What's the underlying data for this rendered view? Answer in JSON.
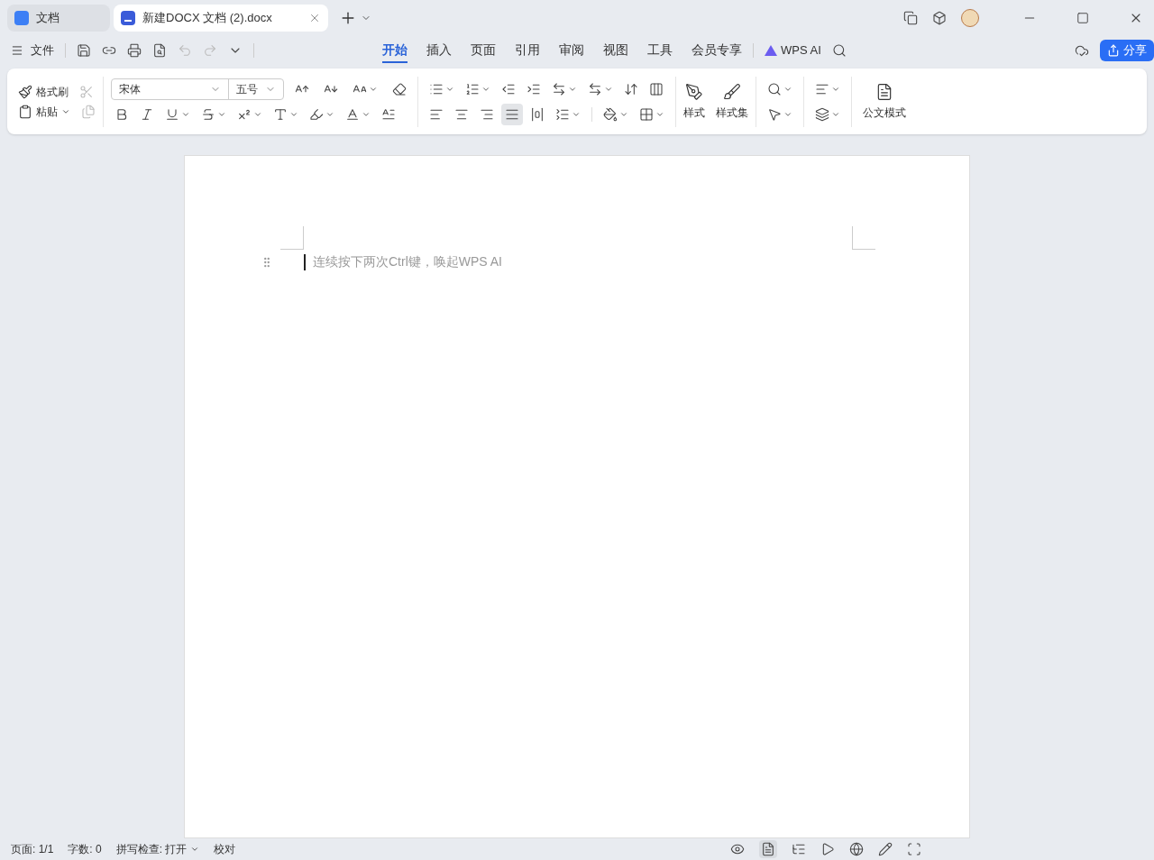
{
  "doc_tabs": [
    {
      "label": "文档",
      "kind": "home",
      "selected": false
    },
    {
      "label": "新建DOCX 文档 (2).docx",
      "kind": "word",
      "selected": true
    }
  ],
  "menu": {
    "file": "文件"
  },
  "ribbon_tabs": [
    {
      "label": "开始",
      "selected": true
    },
    {
      "label": "插入",
      "selected": false
    },
    {
      "label": "页面",
      "selected": false
    },
    {
      "label": "引用",
      "selected": false
    },
    {
      "label": "审阅",
      "selected": false
    },
    {
      "label": "视图",
      "selected": false
    },
    {
      "label": "工具",
      "selected": false
    },
    {
      "label": "会员专享",
      "selected": false
    }
  ],
  "ai_label": "WPS AI",
  "share": "分享",
  "clipboard": {
    "format_painter": "格式刷",
    "paste": "粘贴"
  },
  "font": {
    "name": "宋体",
    "size": "五号"
  },
  "alignment": [
    {
      "kind": "left",
      "selected": false
    },
    {
      "kind": "center",
      "selected": false
    },
    {
      "kind": "right",
      "selected": false
    },
    {
      "kind": "justify",
      "selected": true
    },
    {
      "kind": "distribute",
      "selected": false
    }
  ],
  "styles": {
    "style": "样式",
    "style_set": "样式集",
    "official": "公文模式"
  },
  "document": {
    "placeholder": "连续按下两次Ctrl键，唤起WPS AI"
  },
  "status_bar": {
    "page": "页面: 1/1",
    "words": "字数: 0",
    "spell": "拼写检查: 打开",
    "proof": "校对"
  }
}
